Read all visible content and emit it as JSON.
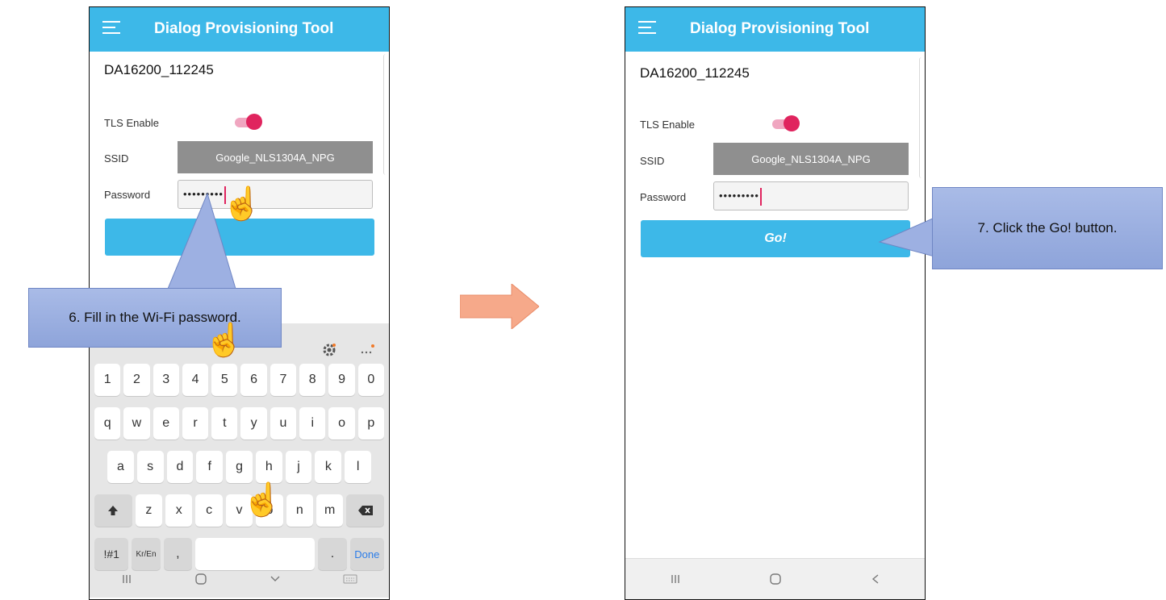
{
  "app": {
    "title": "Dialog Provisioning Tool",
    "device_name": "DA16200_112245"
  },
  "form": {
    "tls_label": "TLS Enable",
    "tls_enabled": true,
    "ssid_label": "SSID",
    "ssid_value": "Google_NLS1304A_NPG",
    "password_label": "Password",
    "password_mask": "•••••••••",
    "go_label": "Go!"
  },
  "keyboard": {
    "toolbar_icons": [
      "settings-icon",
      "more-icon"
    ],
    "numbers": [
      "1",
      "2",
      "3",
      "4",
      "5",
      "6",
      "7",
      "8",
      "9",
      "0"
    ],
    "row1": [
      "q",
      "w",
      "e",
      "r",
      "t",
      "y",
      "u",
      "i",
      "o",
      "p"
    ],
    "row2": [
      "a",
      "s",
      "d",
      "f",
      "g",
      "h",
      "j",
      "k",
      "l"
    ],
    "row3": [
      "z",
      "x",
      "c",
      "v",
      "b",
      "n",
      "m"
    ],
    "symbols_key": "!#1",
    "lang_key": "Kr/En",
    "comma_key": ",",
    "period_key": ".",
    "done_key": "Done"
  },
  "callouts": {
    "step6": "6. Fill in the Wi-Fi password.",
    "step7": "7. Click the Go! button."
  },
  "colors": {
    "appbar": "#3db8e8",
    "toggle": "#e0245e",
    "callout": "#9db0e2",
    "arrow": "#f6a98a"
  }
}
